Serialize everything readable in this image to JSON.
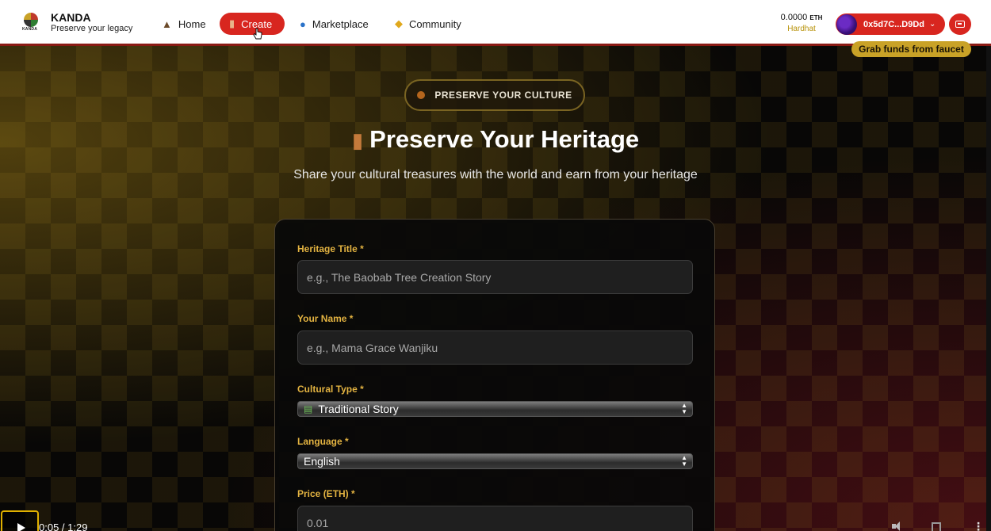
{
  "brand": {
    "name": "KANDA",
    "tagline": "Preserve your legacy",
    "logo_mini": "KANDA"
  },
  "nav": {
    "items": [
      {
        "label": "Home",
        "icon": "hut-icon"
      },
      {
        "label": "Create",
        "icon": "drum-icon",
        "active": true
      },
      {
        "label": "Marketplace",
        "icon": "globe-icon"
      },
      {
        "label": "Community",
        "icon": "handshake-icon"
      }
    ]
  },
  "wallet": {
    "balance": "0.0000",
    "unit": "ETH",
    "network": "Hardhat",
    "address": "0x5d7C...D9Dd",
    "faucet_label": "Grab funds from faucet"
  },
  "hero": {
    "badge": "PRESERVE YOUR CULTURE",
    "title": "Preserve Your Heritage",
    "subtitle": "Share your cultural treasures with the world and earn from your heritage"
  },
  "form": {
    "title_label": "Heritage Title *",
    "title_placeholder": "e.g., The Baobab Tree Creation Story",
    "name_label": "Your Name *",
    "name_placeholder": "e.g., Mama Grace Wanjiku",
    "type_label": "Cultural Type *",
    "type_value": "Traditional Story",
    "language_label": "Language *",
    "language_value": "English",
    "price_label": "Price (ETH) *",
    "price_placeholder": "0.01"
  },
  "video": {
    "time": "0:05 / 1:29"
  },
  "colors": {
    "accent_red": "#d8261f",
    "gold": "#e3b341",
    "nav_border": "#8a1a14"
  }
}
